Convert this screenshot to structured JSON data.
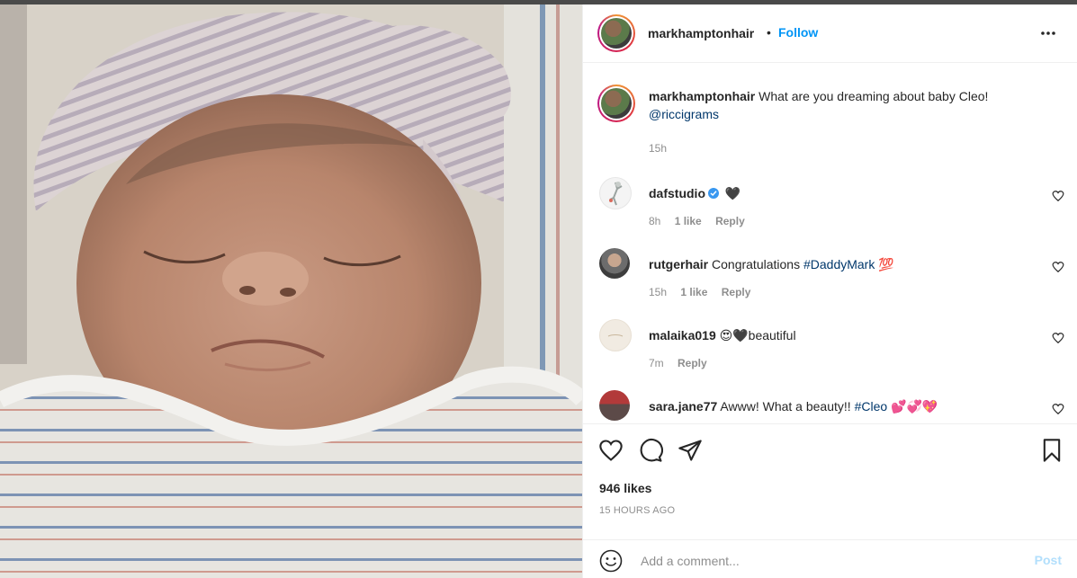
{
  "post": {
    "author": "markhamptonhair",
    "follow_label": "Follow",
    "separator": "•",
    "more_icon": "more-horizontal-icon",
    "photo_alt": "Sleeping newborn baby wearing a striped knit hat"
  },
  "caption": {
    "username": "markhamptonhair",
    "text": "What are you dreaming about baby Cleo!",
    "mention": "@riccigrams",
    "time": "15h"
  },
  "comments": [
    {
      "username": "dafstudio",
      "verified": true,
      "text": "🖤",
      "time": "8h",
      "likes": "1 like",
      "reply": "Reply"
    },
    {
      "username": "rutgerhair",
      "verified": false,
      "text": "Congratulations",
      "hashtag": "#DaddyMark",
      "emoji": "💯",
      "time": "15h",
      "likes": "1 like",
      "reply": "Reply"
    },
    {
      "username": "malaika019",
      "verified": false,
      "text": "😍🖤beautiful",
      "time": "7m",
      "reply": "Reply"
    },
    {
      "username": "sara.jane77",
      "verified": false,
      "text": "Awww! What a beauty!!",
      "hashtag": "#Cleo",
      "emoji": "💕💞💖"
    }
  ],
  "actions": {
    "likes": "946 likes",
    "timestamp": "15 HOURS AGO"
  },
  "composer": {
    "placeholder": "Add a comment...",
    "post_label": "Post"
  },
  "colors": {
    "accent": "#0095f6",
    "link": "#00376b",
    "muted": "#8e8e8e",
    "post_disabled": "#b2dffc",
    "verified": "#3897f0"
  }
}
